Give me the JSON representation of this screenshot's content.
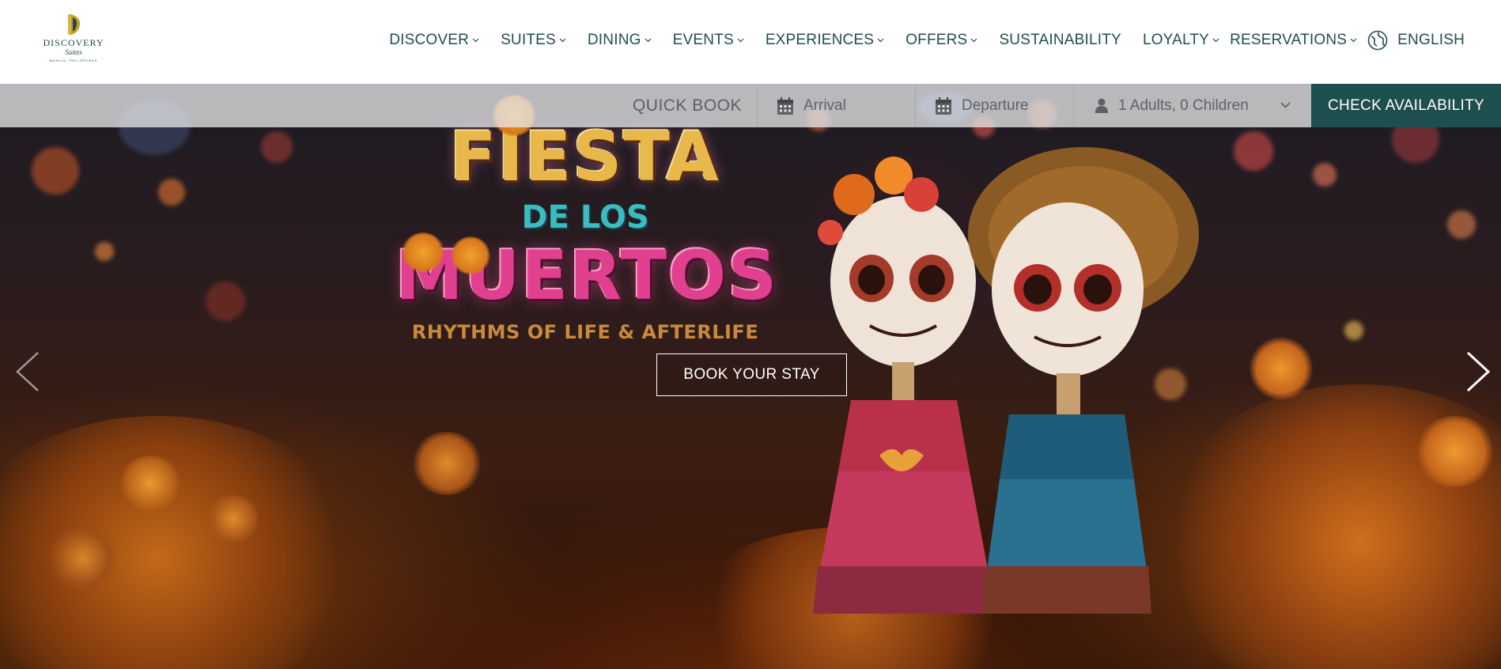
{
  "logo": {
    "name": "DISCOVERY",
    "sub": "Suites",
    "location": "MANILA, PHILIPPINES"
  },
  "nav": {
    "items": [
      {
        "label": "DISCOVER",
        "dropdown": true
      },
      {
        "label": "SUITES",
        "dropdown": true
      },
      {
        "label": "DINING",
        "dropdown": true
      },
      {
        "label": "EVENTS",
        "dropdown": true
      },
      {
        "label": "EXPERIENCES",
        "dropdown": true
      },
      {
        "label": "OFFERS",
        "dropdown": true
      },
      {
        "label": "SUSTAINABILITY",
        "dropdown": false
      },
      {
        "label": "LOYALTY",
        "dropdown": true
      },
      {
        "label": "RESERVATIONS",
        "dropdown": true
      }
    ],
    "language": "ENGLISH"
  },
  "quick_book": {
    "label": "QUICK BOOK",
    "arrival_placeholder": "Arrival",
    "departure_placeholder": "Departure",
    "guests_value": "1 Adults, 0 Children",
    "check_button": "CHECK AVAILABILITY"
  },
  "hero": {
    "title_line1": "FIESTA",
    "title_line2": "DE LOS",
    "title_line3": "MUERTOS",
    "tagline": "RHYTHMS OF LIFE & AFTERLIFE",
    "cta": "BOOK YOUR STAY",
    "prev_icon": "chevron-left-icon",
    "next_icon": "chevron-right-icon"
  },
  "colors": {
    "brand_teal": "#1c4f4d",
    "nav_text": "#1e4f52",
    "quickbook_bg": "#e6e6e8",
    "title_gold": "#e8b84a",
    "title_teal": "#3bbcc0",
    "title_pink": "#e0408e",
    "tagline": "#c98a3c"
  }
}
